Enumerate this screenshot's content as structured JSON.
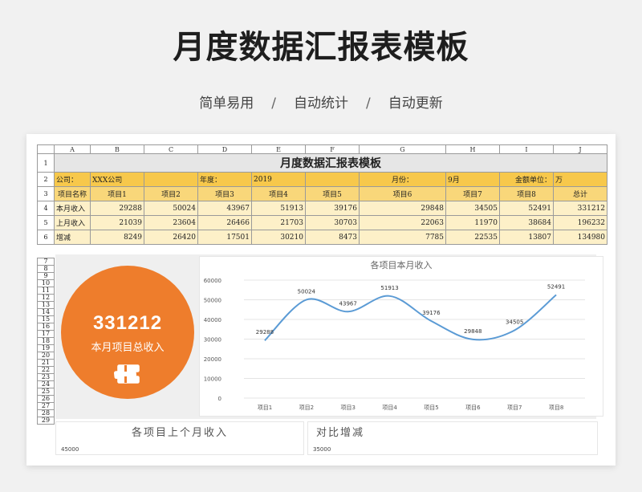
{
  "header": {
    "title": "月度数据汇报表模板",
    "tags": [
      "简单易用",
      "自动统计",
      "自动更新"
    ],
    "separator": "/"
  },
  "sheet": {
    "col_letters": [
      "A",
      "B",
      "C",
      "D",
      "E",
      "F",
      "G",
      "H",
      "I",
      "J"
    ],
    "row1_title": "月度数据汇报表模板",
    "row2": {
      "company_label": "公司：",
      "company_value": "XXX公司",
      "year_label": "年度：",
      "year_value": "2019",
      "month_label": "月份：",
      "month_value": "9月",
      "unit_label": "金额单位：",
      "unit_value": "万"
    },
    "table_headers": [
      "项目名称",
      "项目1",
      "项目2",
      "项目3",
      "项目4",
      "项目5",
      "项目6",
      "项目7",
      "项目8",
      "总计"
    ],
    "rows": [
      {
        "label": "本月收入",
        "values": [
          "29288",
          "50024",
          "43967",
          "51913",
          "39176",
          "29848",
          "34505",
          "52491",
          "331212"
        ]
      },
      {
        "label": "上月收入",
        "values": [
          "21039",
          "23604",
          "26466",
          "21703",
          "30703",
          "22063",
          "11970",
          "38684",
          "196232"
        ]
      },
      {
        "label": "增减",
        "values": [
          "8249",
          "26420",
          "17501",
          "30210",
          "8473",
          "7785",
          "22535",
          "13807",
          "134980"
        ]
      }
    ],
    "extra_row_numbers": [
      "7",
      "8",
      "9",
      "10",
      "11",
      "12",
      "13",
      "14",
      "15",
      "16",
      "17",
      "18",
      "19",
      "20",
      "21",
      "22",
      "23",
      "24",
      "25",
      "26",
      "27",
      "28",
      "29"
    ]
  },
  "summary": {
    "total": "331212",
    "caption": "本月项目总收入",
    "icon": "money-stack-icon",
    "color": "#ee7d2c"
  },
  "panels": {
    "last_month_title": "各项目上个月收入",
    "last_month_top_tick": "45000",
    "compare_title": "对比增减",
    "compare_top_tick": "35000"
  },
  "chart_data": {
    "type": "line",
    "title": "各项目本月收入",
    "categories": [
      "项目1",
      "项目2",
      "项目3",
      "项目4",
      "项目5",
      "项目6",
      "项目7",
      "项目8"
    ],
    "values": [
      29288,
      50024,
      43967,
      51913,
      39176,
      29848,
      34505,
      52491
    ],
    "ylim": [
      0,
      60000
    ],
    "yticks": [
      "0",
      "10000",
      "20000",
      "30000",
      "40000",
      "50000",
      "60000"
    ],
    "grid": true,
    "series_color": "#5b9bd5"
  }
}
